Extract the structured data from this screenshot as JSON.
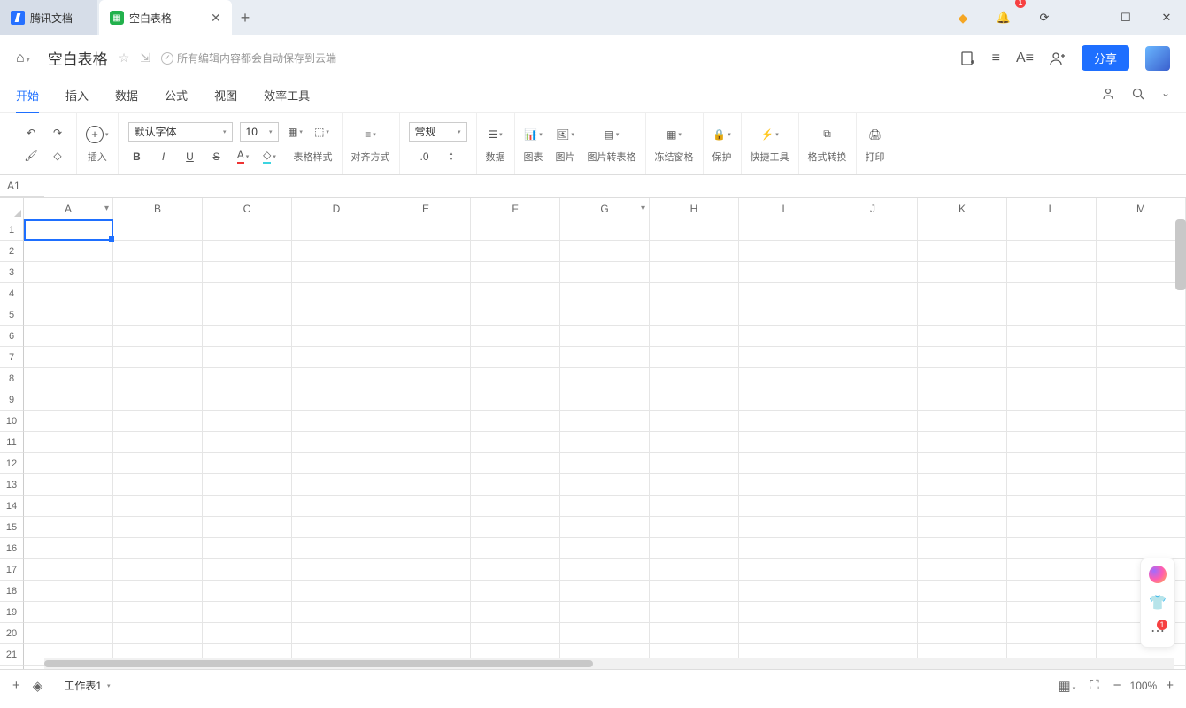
{
  "titlebar": {
    "app_tab": "腾讯文档",
    "doc_tab": "空白表格",
    "notif_count": "1"
  },
  "docheader": {
    "title": "空白表格",
    "save_status": "所有编辑内容都会自动保存到云端",
    "share": "分享"
  },
  "menus": [
    "开始",
    "插入",
    "数据",
    "公式",
    "视图",
    "效率工具"
  ],
  "toolbar": {
    "insert_label": "插入",
    "font": "默认字体",
    "font_size": "10",
    "table_style": "表格样式",
    "align": "对齐方式",
    "numfmt": "常规",
    "decimal": ".0",
    "data": "数据",
    "chart": "图表",
    "image": "图片",
    "img2table": "图片转表格",
    "freeze": "冻结窗格",
    "protect": "保护",
    "quick": "快捷工具",
    "fmtconv": "格式转换",
    "print": "打印"
  },
  "namebox": "A1",
  "columns": [
    "A",
    "B",
    "C",
    "D",
    "E",
    "F",
    "G",
    "H",
    "I",
    "J",
    "K",
    "L",
    "M"
  ],
  "filter_cols": [
    "A",
    "G"
  ],
  "rows": 22,
  "statusbar": {
    "sheet": "工作表1",
    "zoom": "100%"
  },
  "side_badge": "1"
}
